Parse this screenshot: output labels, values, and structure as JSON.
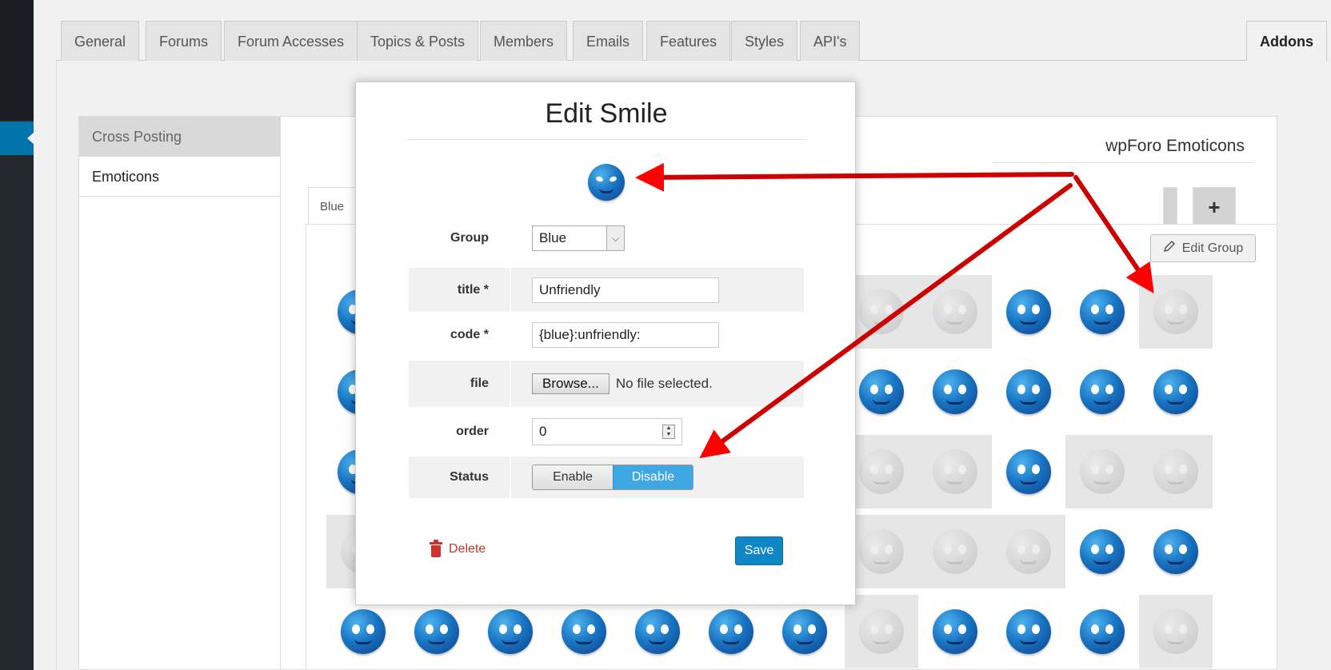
{
  "top_tabs": [
    {
      "label": "General"
    },
    {
      "label": "Forums"
    },
    {
      "label": "Forum Accesses"
    },
    {
      "label": "Topics & Posts"
    },
    {
      "label": "Members"
    },
    {
      "label": "Emails"
    },
    {
      "label": "Features"
    },
    {
      "label": "Styles"
    },
    {
      "label": "API's"
    },
    {
      "label": "Addons",
      "active": true
    }
  ],
  "subnav": {
    "items": [
      {
        "label": "Cross Posting"
      },
      {
        "label": "Emoticons",
        "active": true
      }
    ]
  },
  "addon": {
    "title": "wpForo Emoticons",
    "group_tab": "Blue",
    "add_group": "+",
    "edit_group_label": "Edit Group"
  },
  "modal": {
    "title": "Edit Smile",
    "preview_icon": "unfriendly-smiley-icon",
    "fields": {
      "group": {
        "label": "Group",
        "value": "Blue"
      },
      "title": {
        "label": "title *",
        "value": "Unfriendly"
      },
      "code": {
        "label": "code *",
        "value": "{blue}:unfriendly:"
      },
      "file": {
        "label": "file",
        "button": "Browse...",
        "status": "No file selected."
      },
      "order": {
        "label": "order",
        "value": "0"
      },
      "status": {
        "label": "Status",
        "options": [
          "Enable",
          "Disable"
        ],
        "selected": "Disable"
      }
    },
    "delete_label": "Delete",
    "save_label": "Save"
  },
  "colors": {
    "accent": "#0f87c6",
    "toggle_on": "#3fa7e2",
    "delete": "#c0392b",
    "annotation_arrow": "#ff0000",
    "admin_sidebar": "#23282d"
  }
}
